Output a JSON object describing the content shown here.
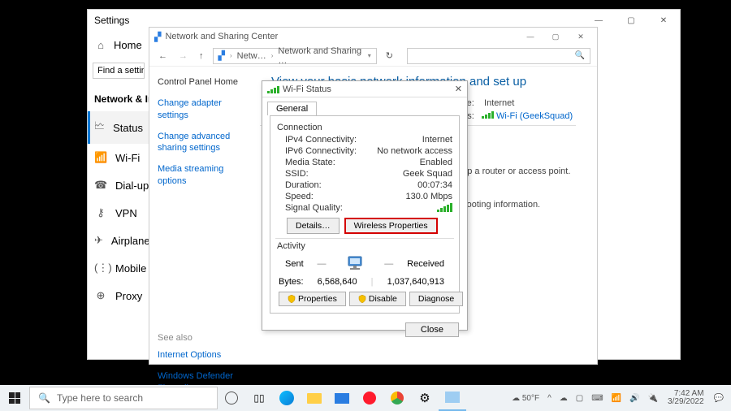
{
  "settings": {
    "title": "Settings",
    "home": "Home",
    "search_placeholder": "Find a setting",
    "section": "Network & Internet",
    "items": [
      {
        "icon": "🗠",
        "label": "Status"
      },
      {
        "icon": "📶",
        "label": "Wi-Fi"
      },
      {
        "icon": "☎",
        "label": "Dial-up"
      },
      {
        "icon": "⚷",
        "label": "VPN"
      },
      {
        "icon": "✈",
        "label": "Airplane mode"
      },
      {
        "icon": "(⋮)",
        "label": "Mobile hotspot"
      },
      {
        "icon": "⊕",
        "label": "Proxy"
      }
    ]
  },
  "ncpl": {
    "title": "Network and Sharing Center",
    "breadcrumb": {
      "root": "Netw…",
      "current": "Network and Sharing …"
    },
    "left": {
      "home": "Control Panel Home",
      "links": [
        "Change adapter settings",
        "Change advanced sharing settings",
        "Media streaming options"
      ],
      "seealso_heading": "See also",
      "seealso": [
        "Internet Options",
        "Windows Defender Firewall"
      ]
    },
    "main": {
      "heading": "View your basic network information and set up connections",
      "type_label": "ype:",
      "type_value": "Internet",
      "conn_label": "ons:",
      "conn_value": "Wi-Fi (GeekSquad)",
      "hint1": "t up a router or access point.",
      "hint2": "shooting information."
    }
  },
  "wifi": {
    "title": "Wi-Fi Status",
    "tab": "General",
    "group_connection": "Connection",
    "rows": [
      {
        "k": "IPv4 Connectivity:",
        "v": "Internet"
      },
      {
        "k": "IPv6 Connectivity:",
        "v": "No network access"
      },
      {
        "k": "Media State:",
        "v": "Enabled"
      },
      {
        "k": "SSID:",
        "v": "Geek Squad"
      },
      {
        "k": "Duration:",
        "v": "00:07:34"
      },
      {
        "k": "Speed:",
        "v": "130.0 Mbps"
      }
    ],
    "signal_label": "Signal Quality:",
    "details_btn": "Details…",
    "wireless_btn": "Wireless Properties",
    "group_activity": "Activity",
    "sent_label": "Sent",
    "received_label": "Received",
    "bytes_label": "Bytes:",
    "bytes_sent": "6,568,640",
    "bytes_recv": "1,037,640,913",
    "prop_btn": "Properties",
    "disable_btn": "Disable",
    "diagnose_btn": "Diagnose",
    "close_btn": "Close"
  },
  "taskbar": {
    "search_placeholder": "Type here to search",
    "weather": "50°F",
    "time": "7:42 AM",
    "date": "3/29/2022"
  }
}
